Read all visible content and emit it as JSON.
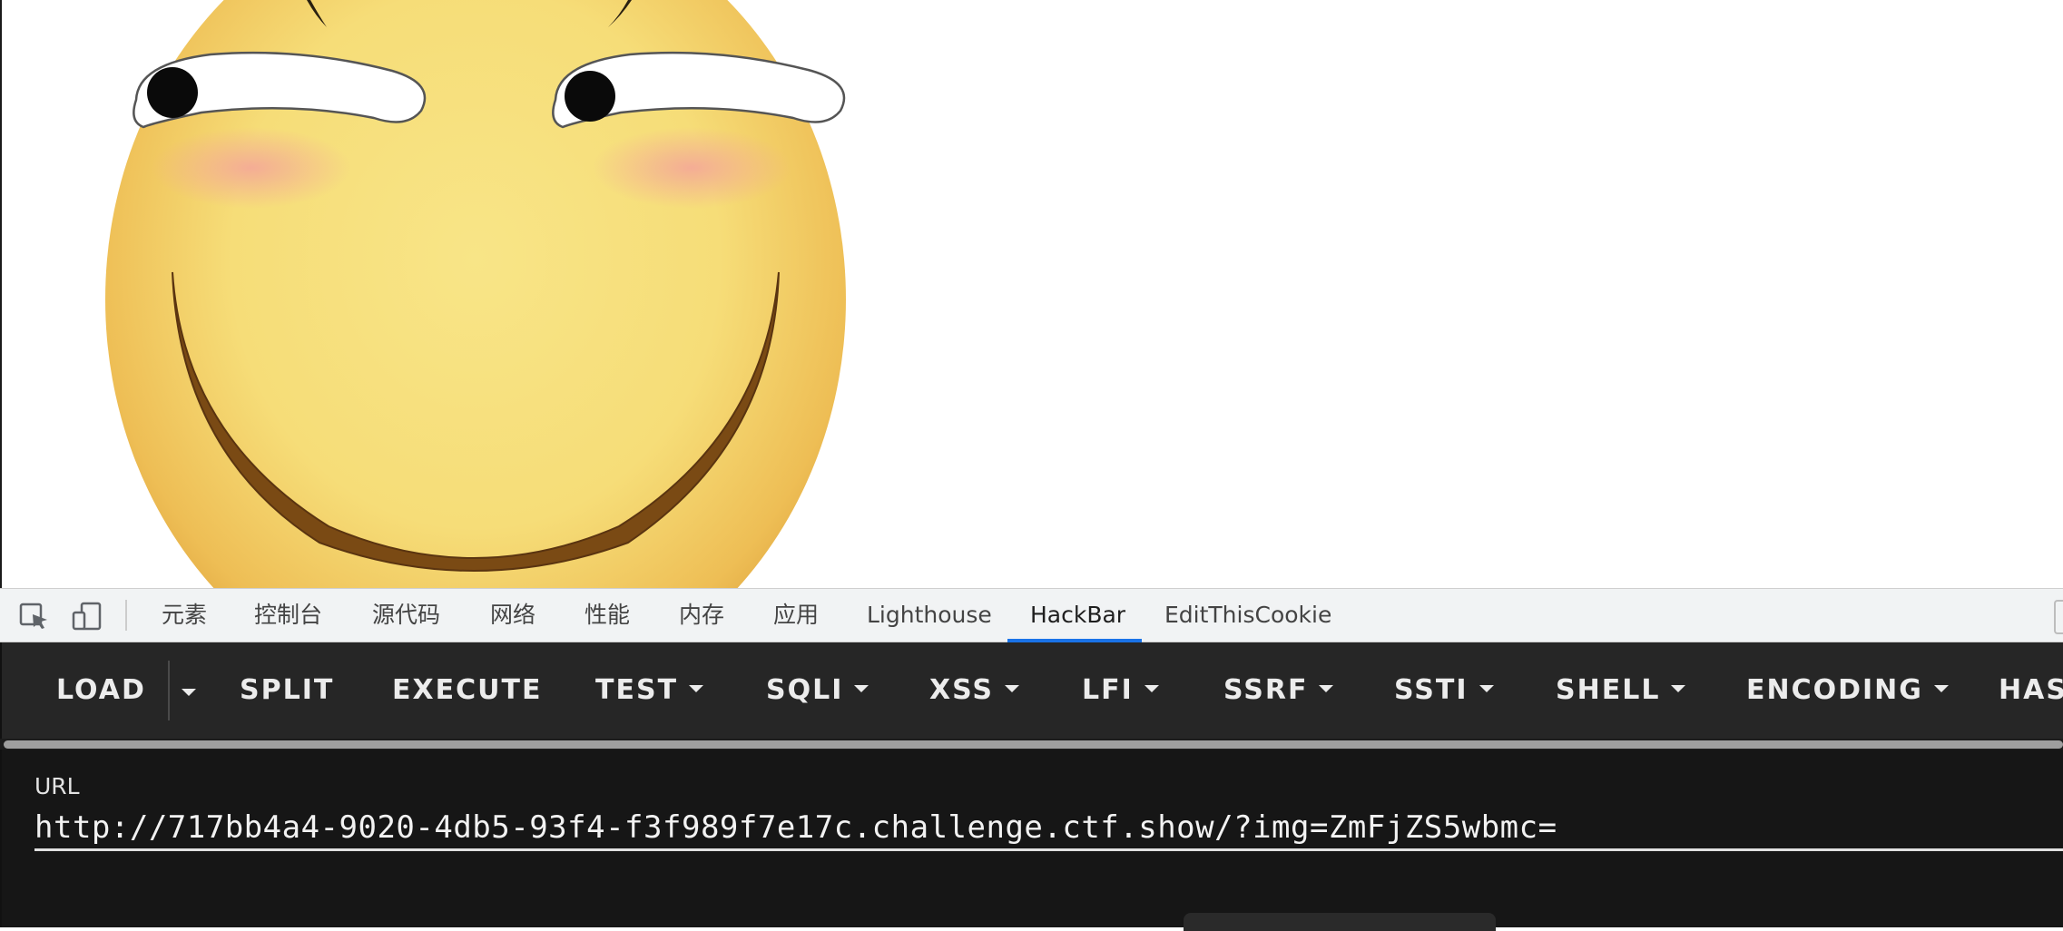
{
  "devtools": {
    "tabs": [
      {
        "label": "元素"
      },
      {
        "label": "控制台"
      },
      {
        "label": "源代码"
      },
      {
        "label": "网络"
      },
      {
        "label": "性能"
      },
      {
        "label": "内存"
      },
      {
        "label": "应用"
      },
      {
        "label": "Lighthouse"
      },
      {
        "label": "HackBar",
        "active": true
      },
      {
        "label": "EditThisCookie"
      }
    ],
    "icons": [
      "inspect-element-icon",
      "device-toolbar-icon"
    ],
    "active_tab_color": "#1a73e8"
  },
  "hackbar": {
    "buttons": [
      {
        "label": "LOAD",
        "dropdown": false
      },
      {
        "label": "SPLIT",
        "dropdown": false
      },
      {
        "label": "EXECUTE",
        "dropdown": false
      },
      {
        "label": "TEST",
        "dropdown": true
      },
      {
        "label": "SQLI",
        "dropdown": true
      },
      {
        "label": "XSS",
        "dropdown": true
      },
      {
        "label": "LFI",
        "dropdown": true
      },
      {
        "label": "SSRF",
        "dropdown": true
      },
      {
        "label": "SSTI",
        "dropdown": true
      },
      {
        "label": "SHELL",
        "dropdown": true
      },
      {
        "label": "ENCODING",
        "dropdown": true
      },
      {
        "label": "HAS",
        "dropdown": false
      }
    ],
    "url_label": "URL",
    "url_value": "http://717bb4a4-9020-4db5-93f4-f3f989f7e17c.challenge.ctf.show/?img=ZmFjZS5wbmc="
  },
  "colors": {
    "toolbar_bg": "#262626",
    "panel_bg": "#161616",
    "tabbar_bg": "#f1f3f4"
  }
}
